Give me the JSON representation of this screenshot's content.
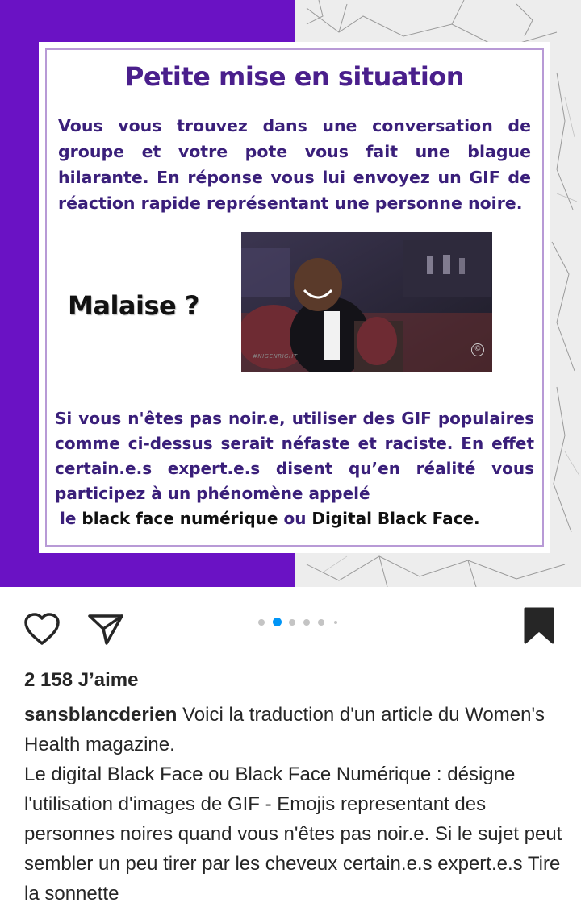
{
  "post": {
    "title": "Petite mise en situation",
    "paragraph1": "Vous vous trouvez dans une conversation de groupe et votre pote vous fait une blague hilarante. En réponse vous lui envoyez un GIF de réaction rapide représentant une personne noire.",
    "malaise": "Malaise ?",
    "gif_watermark": "#NIGENRIGHT",
    "gif_logo": "©",
    "paragraph2_start": "Si vous n'êtes pas noir.e, utiliser des GIF populaires comme ci-dessus serait néfaste et raciste. En effet certain.e.s expert.e.s disent qu’en réalité vous participez à un phénomène appelé",
    "paragraph2_le": "le",
    "paragraph2_term1": "black face numérique",
    "paragraph2_ou": "ou",
    "paragraph2_term2": "Digital Black Face."
  },
  "actions": {
    "like_icon": "heart-outline-icon",
    "share_icon": "paper-plane-icon",
    "save_icon": "bookmark-filled-icon",
    "carousel_dots": 6,
    "carousel_active_index": 1
  },
  "stats": {
    "likes": "2 158 J’aime"
  },
  "caption": {
    "username": "sansblancderien",
    "text": " Voici la traduction d'un article du Women's Health magazine.",
    "line2": "Le digital Black Face ou Black Face Numérique : désigne l'utilisation d'images de GIF - Emojis representant des personnes noires quand vous n'êtes pas noir.e. Si le sujet peut sembler un peu tirer par les cheveux certain.e.s expert.e.s Tire la sonnette"
  },
  "colors": {
    "purple": "#6a12c4",
    "title_text": "#4a1f8c",
    "body_text": "#3a1f7a",
    "accent_blue": "#0095f6"
  }
}
